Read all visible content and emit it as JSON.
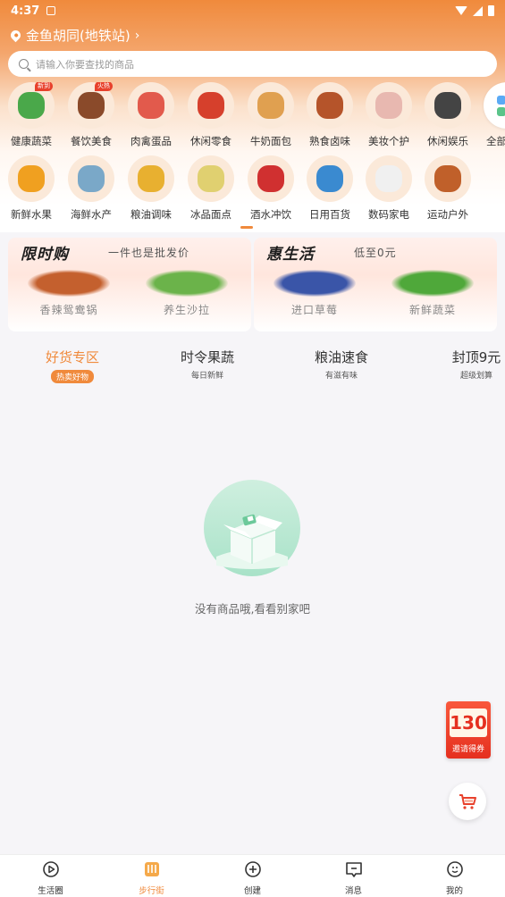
{
  "status_bar": {
    "time": "4:37"
  },
  "location": {
    "label": "金鱼胡同(地铁站)",
    "chevron": "›"
  },
  "search": {
    "placeholder": "请输入你要查找的商品"
  },
  "categories": [
    {
      "label": "健康蔬菜",
      "badge": "新到",
      "icon": "vegetable-icon",
      "color": "#4aa84a"
    },
    {
      "label": "餐饮美食",
      "badge": "火热",
      "icon": "food-icon",
      "color": "#8a4a2a"
    },
    {
      "label": "肉禽蛋品",
      "badge": "",
      "icon": "meat-icon",
      "color": "#e25a4c"
    },
    {
      "label": "休闲零食",
      "badge": "",
      "icon": "snack-icon",
      "color": "#d6402c"
    },
    {
      "label": "牛奶面包",
      "badge": "",
      "icon": "bread-icon",
      "color": "#e0a050"
    },
    {
      "label": "熟食卤味",
      "badge": "",
      "icon": "deli-icon",
      "color": "#b5542a"
    },
    {
      "label": "美妆个护",
      "badge": "",
      "icon": "cosmetics-icon",
      "color": "#e8b8b0"
    },
    {
      "label": "休闲娱乐",
      "badge": "",
      "icon": "entertainment-icon",
      "color": "#444444"
    },
    {
      "label": "全部分类",
      "badge": "",
      "icon": "all-categories-icon",
      "color": "#ffffff"
    },
    {
      "label": "新鲜水果",
      "badge": "",
      "icon": "fruit-icon",
      "color": "#f0a020"
    },
    {
      "label": "海鲜水产",
      "badge": "",
      "icon": "seafood-icon",
      "color": "#7aa8c8"
    },
    {
      "label": "粮油调味",
      "badge": "",
      "icon": "grain-oil-icon",
      "color": "#e8b030"
    },
    {
      "label": "冰品面点",
      "badge": "",
      "icon": "frozen-food-icon",
      "color": "#e0d070"
    },
    {
      "label": "酒水冲饮",
      "badge": "",
      "icon": "drinks-icon",
      "color": "#d03030"
    },
    {
      "label": "日用百货",
      "badge": "",
      "icon": "daily-goods-icon",
      "color": "#3a8ad0"
    },
    {
      "label": "数码家电",
      "badge": "",
      "icon": "appliance-icon",
      "color": "#f0f0f0"
    },
    {
      "label": "运动户外",
      "badge": "",
      "icon": "sports-icon",
      "color": "#c0602a"
    }
  ],
  "promos": [
    {
      "title": "限时购",
      "subtitle": "一件也是批发价",
      "products": [
        {
          "name": "香辣鸳鸯锅",
          "color": "#c4602e"
        },
        {
          "name": "养生沙拉",
          "color": "#6bb34a"
        }
      ]
    },
    {
      "title": "惠生活",
      "subtitle": "低至0元",
      "products": [
        {
          "name": "进口草莓",
          "color": "#3a55a8"
        },
        {
          "name": "新鲜蔬菜",
          "color": "#4fa83a"
        }
      ]
    }
  ],
  "tabs": [
    {
      "title": "好货专区",
      "sub": "热卖好物",
      "active": true
    },
    {
      "title": "时令果蔬",
      "sub": "每日新鲜",
      "active": false
    },
    {
      "title": "粮油速食",
      "sub": "有滋有味",
      "active": false
    },
    {
      "title": "封顶9元",
      "sub": "超级划算",
      "active": false
    }
  ],
  "empty_state": {
    "message": "没有商品哦,看看别家吧"
  },
  "invite": {
    "amount": "130",
    "currency": "¥",
    "label": "邀请得券"
  },
  "bottom_nav": [
    {
      "label": "生活圈",
      "icon": "play-circle-icon",
      "active": false
    },
    {
      "label": "步行街",
      "icon": "shop-icon",
      "active": true
    },
    {
      "label": "创建",
      "icon": "plus-circle-icon",
      "active": false
    },
    {
      "label": "消息",
      "icon": "message-icon",
      "active": false
    },
    {
      "label": "我的",
      "icon": "profile-icon",
      "active": false
    }
  ],
  "colors": {
    "accent": "#f08a3c",
    "badge": "#e8412c",
    "invite": "#e5301f",
    "empty_illustration": "#a8e2c8"
  }
}
